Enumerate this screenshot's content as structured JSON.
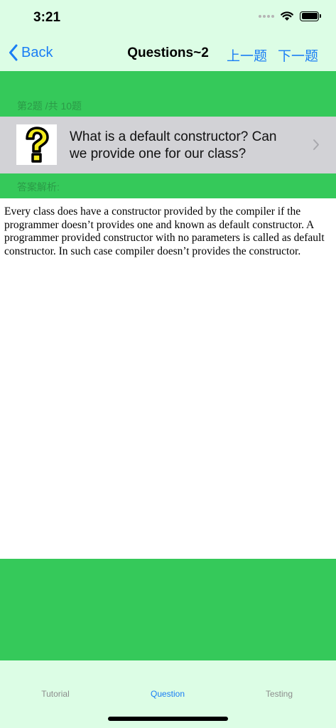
{
  "status_bar": {
    "time": "3:21"
  },
  "nav": {
    "back_label": "Back",
    "title": "Questions~2",
    "prev_label": "上一题",
    "next_label": "下一题"
  },
  "question": {
    "progress": "第2题 /共 10题",
    "text": "What is a default constructor? Can we provide one for our class?",
    "image_icon": "question-mark-icon"
  },
  "answer": {
    "header": "答案解析:",
    "body": "Every class does have a constructor provided by the compiler if the programmer doesn’t provides one and known as default constructor. A programmer provided constructor with no parameters is called as default constructor. In such case compiler doesn’t provides the constructor."
  },
  "tabs": [
    {
      "label": "Tutorial",
      "active": false
    },
    {
      "label": "Question",
      "active": true
    },
    {
      "label": "Testing",
      "active": false
    }
  ],
  "colors": {
    "accent": "#1a7ef5",
    "green": "#35c95a",
    "light_green": "#dcfde5",
    "row_gray": "#d2d2d6"
  }
}
